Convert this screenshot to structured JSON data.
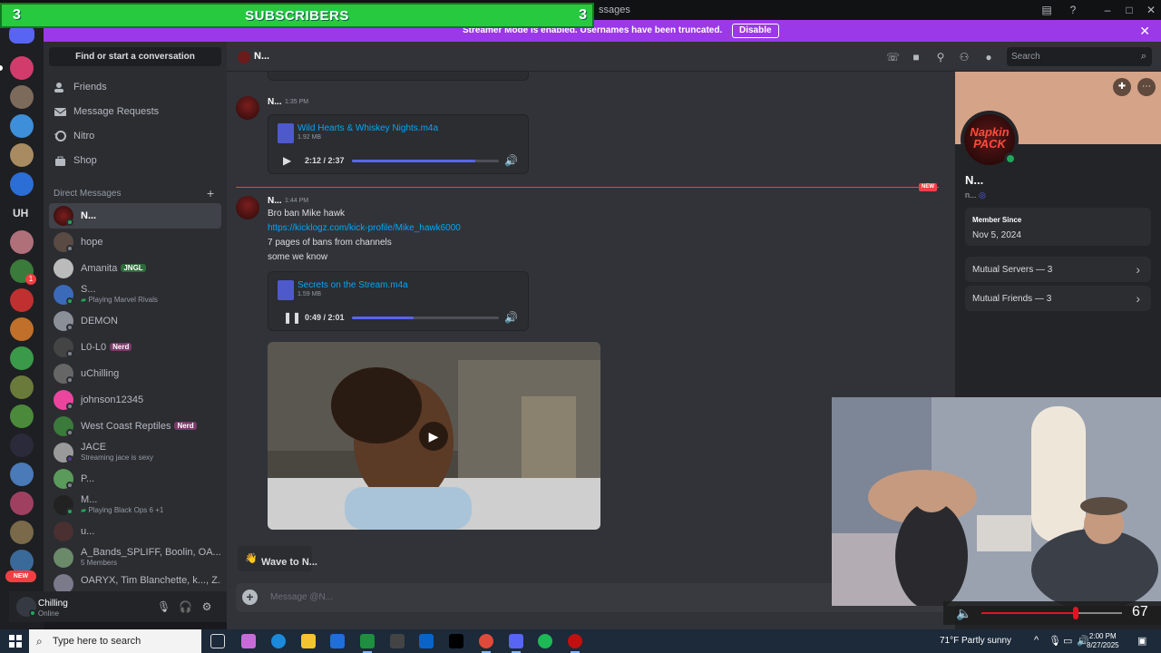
{
  "window": {
    "title_fragment": "ssages"
  },
  "subscriber_overlay": {
    "left_count": "3",
    "label": "SUBSCRIBERS",
    "right_count": "3"
  },
  "streamer_banner": {
    "message": "Streamer Mode is enabled. Usernames have been truncated.",
    "disable_label": "Disable"
  },
  "sidebar": {
    "search_label": "Find or start a conversation",
    "nav": [
      {
        "label": "Friends",
        "icon": "friends-icon"
      },
      {
        "label": "Message Requests",
        "icon": "envelope-icon"
      },
      {
        "label": "Nitro",
        "icon": "nitro-icon"
      },
      {
        "label": "Shop",
        "icon": "shop-icon"
      }
    ],
    "dm_header": "Direct Messages",
    "dms": [
      {
        "name": "N...",
        "sub": "",
        "tag": "",
        "active": true
      },
      {
        "name": "hope",
        "sub": "",
        "tag": ""
      },
      {
        "name": "Amanita",
        "sub": "",
        "tag": "JNGL"
      },
      {
        "name": "S...",
        "sub": "Playing Marvel Rivals",
        "tag": ""
      },
      {
        "name": "DEMON",
        "sub": "",
        "tag": ""
      },
      {
        "name": "L0-L0",
        "sub": "",
        "tag": "Nerd"
      },
      {
        "name": "uChilling",
        "sub": "",
        "tag": ""
      },
      {
        "name": "johnson12345",
        "sub": "",
        "tag": ""
      },
      {
        "name": "West Coast Reptiles",
        "sub": "",
        "tag": "Nerd"
      },
      {
        "name": "JACE",
        "sub": "Streaming jace is sexy",
        "tag": ""
      },
      {
        "name": "P...",
        "sub": "",
        "tag": ""
      },
      {
        "name": "M...",
        "sub": "Playing Black Ops 6 +1",
        "tag": ""
      },
      {
        "name": "u...",
        "sub": "",
        "tag": ""
      },
      {
        "name": "A_Bands_SPLIFF, Boolin, OA...",
        "sub": "5 Members",
        "tag": ""
      },
      {
        "name": "OARYX, Tim Blanchette, k..., Z...",
        "sub": "",
        "tag": ""
      }
    ],
    "rail_labels": {
      "uh": "UH",
      "new_badge": "NEW",
      "mention_count": "1"
    }
  },
  "user_panel": {
    "name": "Chilling",
    "status": "Online"
  },
  "chat": {
    "header_name": "N...",
    "search_placeholder": "Search",
    "messages": [
      {
        "author": "N...",
        "time": "1:35 PM",
        "attachment": {
          "name": "Wild Hearts & Whiskey Nights.m4a",
          "size": "1.92 MB",
          "time": "2:12 / 2:37",
          "progress": 0.84,
          "state": "play"
        }
      },
      {
        "author": "N...",
        "time": "1:44 PM",
        "lines": [
          "Bro ban Mike hawk",
          "7 pages of bans from channels",
          "some we know"
        ],
        "link": "https://kicklogz.com/kick-profile/Mike_hawk6000",
        "attachment": {
          "name": "Secrets on the Stream.m4a",
          "size": "1.59 MB",
          "time": "0:49 / 2:01",
          "progress": 0.42,
          "state": "pause"
        }
      }
    ],
    "new_badge": "NEW",
    "wave_label": "Wave to N...",
    "composer_placeholder": "Message @N..."
  },
  "profile": {
    "avatar_text": "Napkin PACK",
    "name": "N...",
    "handle": "n...",
    "member_since_label": "Member Since",
    "member_since_value": "Nov 5, 2024",
    "mutual_servers": "Mutual Servers — 3",
    "mutual_friends": "Mutual Friends — 3"
  },
  "volume_overlay": {
    "value": "67",
    "level": 0.67
  },
  "taskbar": {
    "search_placeholder": "Type here to search",
    "weather": "71°F  Partly sunny",
    "time": "2:00 PM",
    "date": "8/27/2025"
  },
  "colors": {
    "accent": "#5865f2",
    "streamer": "#9b38e8",
    "sub_green": "#27c93f",
    "online": "#23a55a",
    "danger": "#f23f43",
    "link": "#00a8fc"
  }
}
